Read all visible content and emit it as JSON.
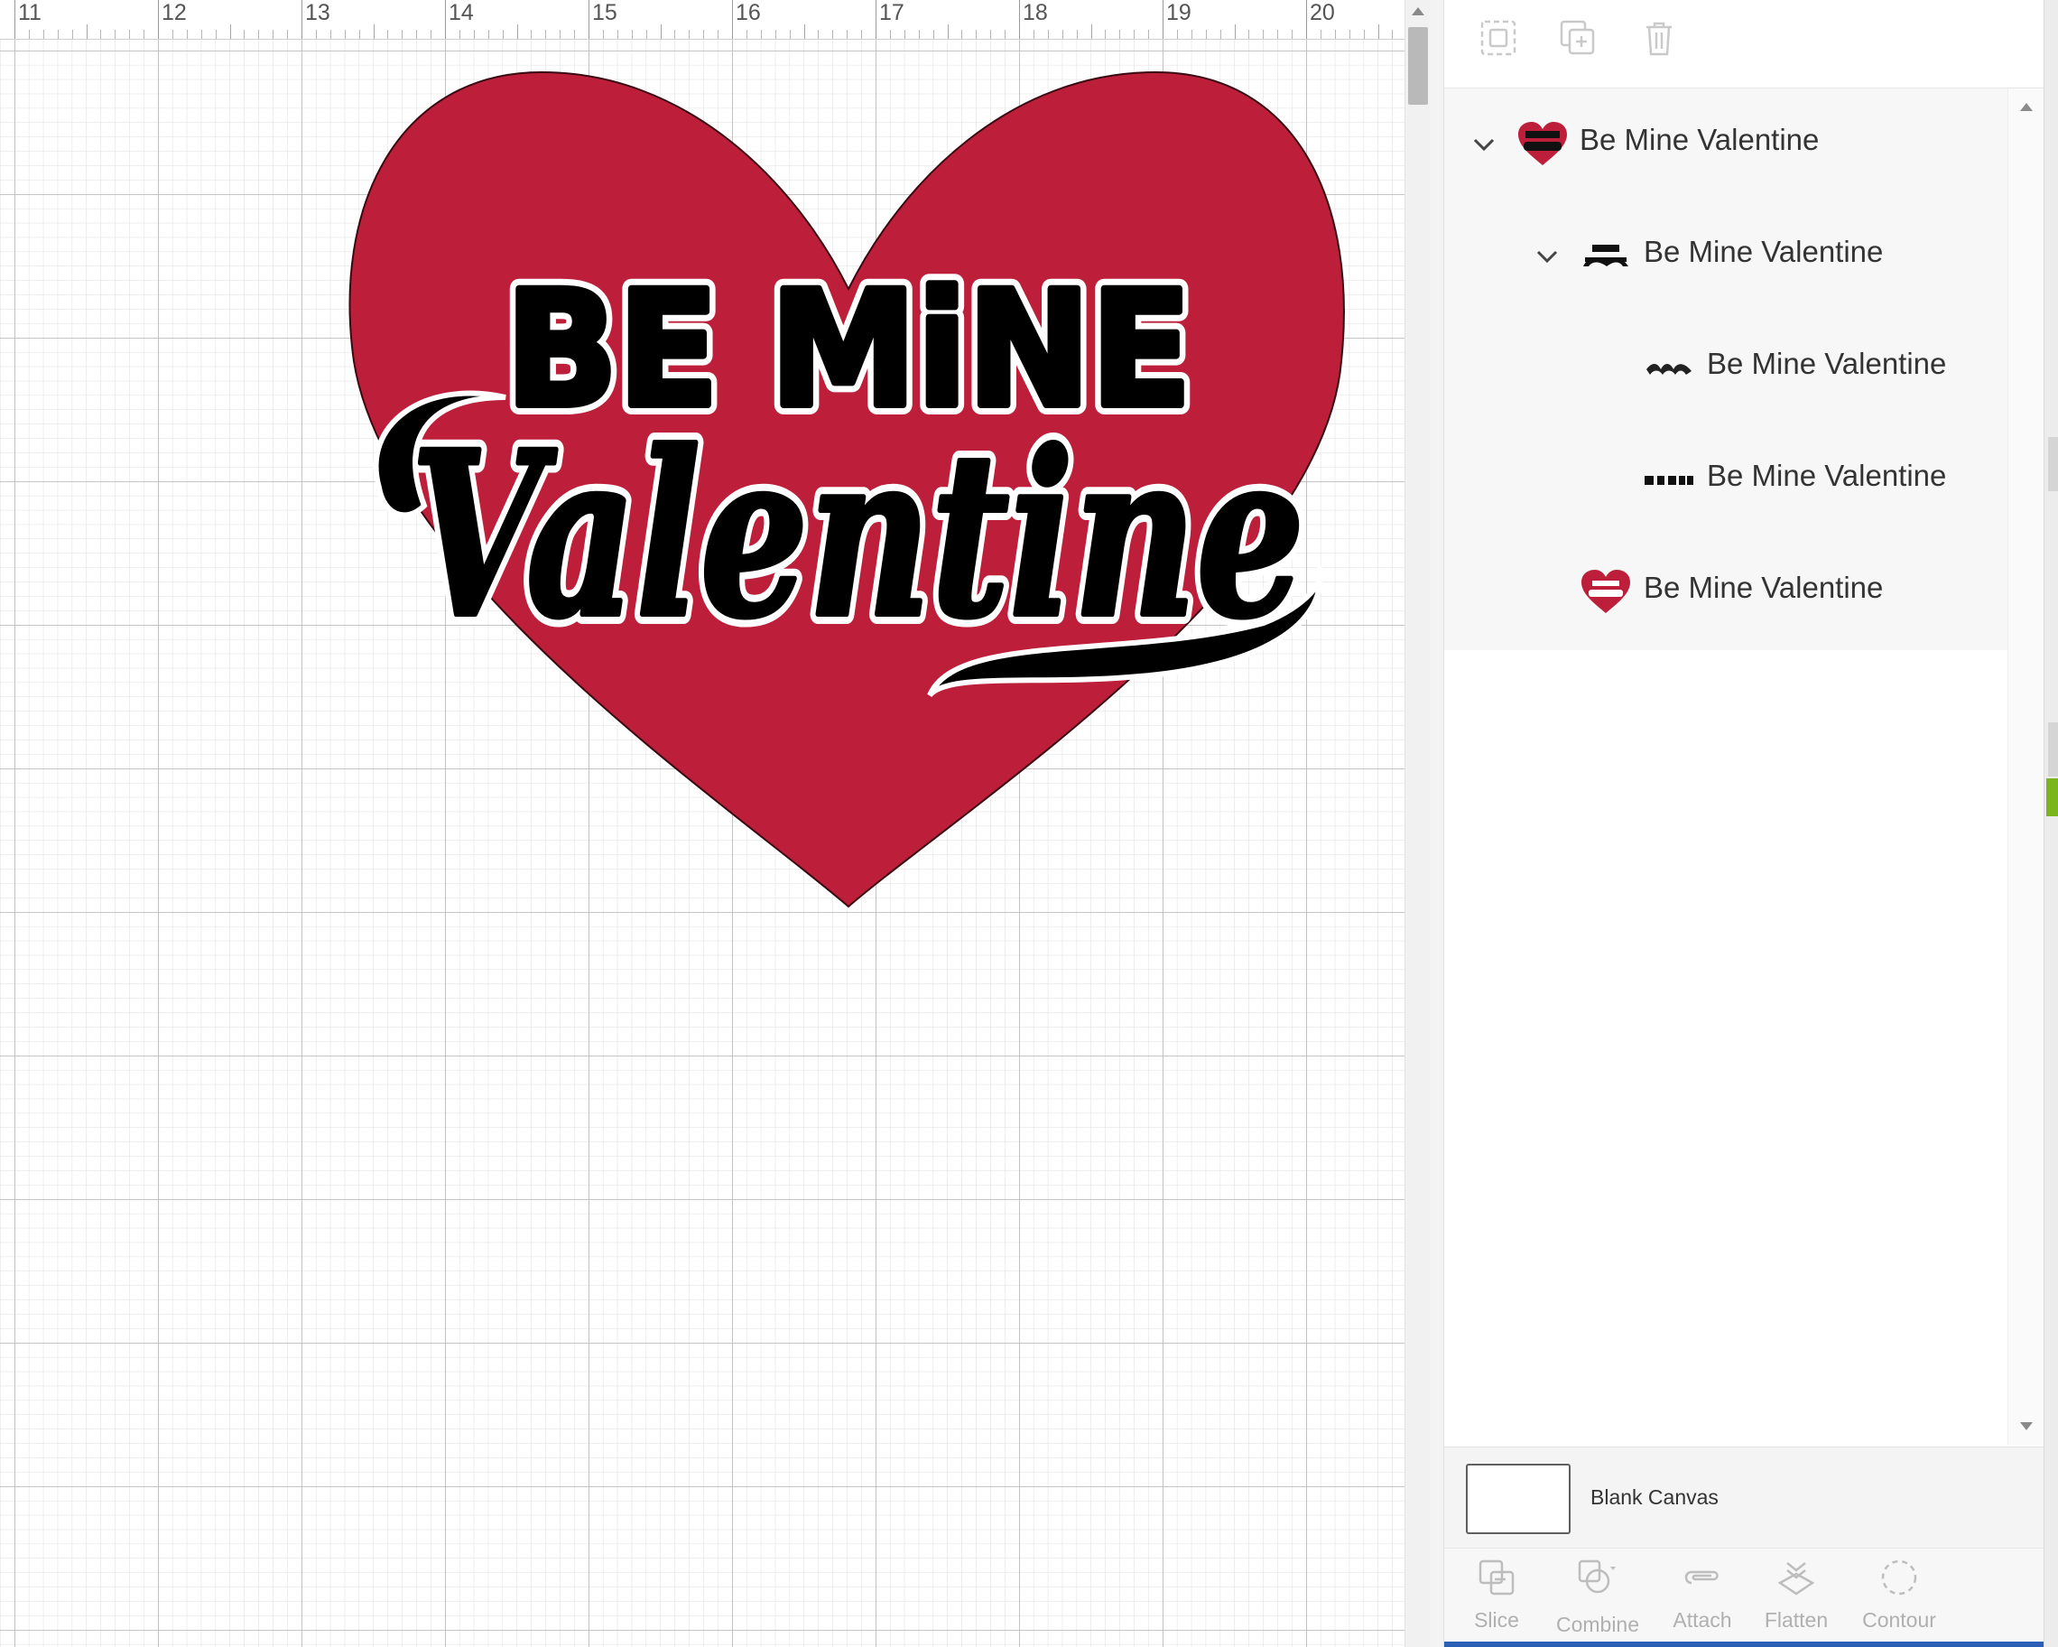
{
  "ruler": {
    "labels": [
      "11",
      "12",
      "13",
      "14",
      "15",
      "16",
      "17",
      "18",
      "19",
      "20"
    ]
  },
  "design": {
    "heart_color": "#bd1f3b",
    "text_top": "BE MiNE",
    "text_script": "Valentine"
  },
  "toolbar": {
    "icons": [
      "group-icon",
      "duplicate-icon",
      "delete-icon"
    ]
  },
  "layers": [
    {
      "label": "Be Mine Valentine",
      "level": 0,
      "expanded": true,
      "thumbnail": "heart-with-text"
    },
    {
      "label": "Be Mine Valentine",
      "level": 1,
      "expanded": true,
      "thumbnail": "text-only"
    },
    {
      "label": "Be Mine Valentine",
      "level": 2,
      "expanded": false,
      "thumbnail": "valentine-script"
    },
    {
      "label": "Be Mine Valentine",
      "level": 2,
      "expanded": false,
      "thumbnail": "be-mine-block"
    },
    {
      "label": "Be Mine Valentine",
      "level": 1,
      "expanded": false,
      "thumbnail": "heart-with-text"
    }
  ],
  "canvas": {
    "label": "Blank Canvas"
  },
  "bottom_tools": [
    {
      "label": "Slice",
      "icon": "slice-icon"
    },
    {
      "label": "Combine",
      "icon": "combine-icon"
    },
    {
      "label": "Attach",
      "icon": "attach-icon"
    },
    {
      "label": "Flatten",
      "icon": "flatten-icon"
    },
    {
      "label": "Contour",
      "icon": "contour-icon"
    }
  ],
  "colors": {
    "accent_blue": "#2a5fb6",
    "heart_red": "#bd1f3b",
    "disabled_gray": "#b0b0b0"
  }
}
